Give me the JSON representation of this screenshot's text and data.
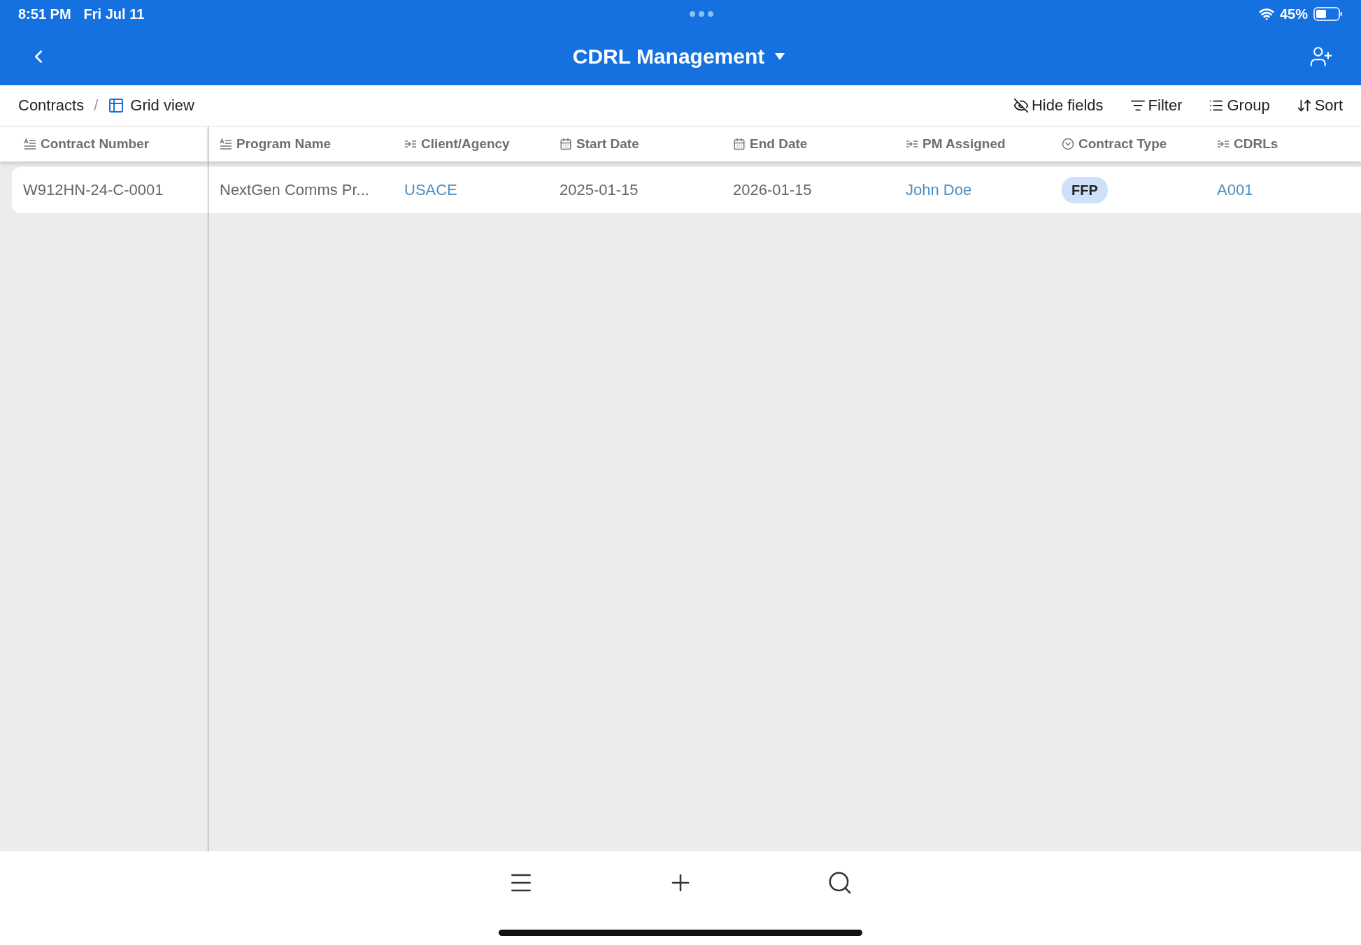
{
  "status_bar": {
    "time": "8:51 PM",
    "date": "Fri Jul 11",
    "battery": "45%"
  },
  "header": {
    "title": "CDRL Management"
  },
  "breadcrumb": {
    "base": "Contracts",
    "separator": "/",
    "view": "Grid view"
  },
  "toolbar": [
    {
      "label": "Hide fields",
      "kind": "hide"
    },
    {
      "label": "Filter",
      "kind": "filter"
    },
    {
      "label": "Group",
      "kind": "group"
    },
    {
      "label": "Sort",
      "kind": "sort"
    }
  ],
  "columns": [
    {
      "label": "Contract Number",
      "kind": "text"
    },
    {
      "label": "Program Name",
      "kind": "text"
    },
    {
      "label": "Client/Agency",
      "kind": "link"
    },
    {
      "label": "Start Date",
      "kind": "date"
    },
    {
      "label": "End Date",
      "kind": "date"
    },
    {
      "label": "PM Assigned",
      "kind": "link"
    },
    {
      "label": "Contract Type",
      "kind": "select"
    },
    {
      "label": "CDRLs",
      "kind": "link"
    }
  ],
  "rows": [
    {
      "cells": [
        {
          "text": "W912HN-24-C-0001",
          "kind": "text"
        },
        {
          "text": "NextGen Comms Pr...",
          "kind": "text"
        },
        {
          "text": "USACE",
          "kind": "link"
        },
        {
          "text": "2025-01-15",
          "kind": "text"
        },
        {
          "text": "2026-01-15",
          "kind": "text"
        },
        {
          "text": "John Doe",
          "kind": "link"
        },
        {
          "text": "FFP",
          "kind": "tag"
        },
        {
          "text": "A001",
          "kind": "link"
        }
      ]
    }
  ]
}
